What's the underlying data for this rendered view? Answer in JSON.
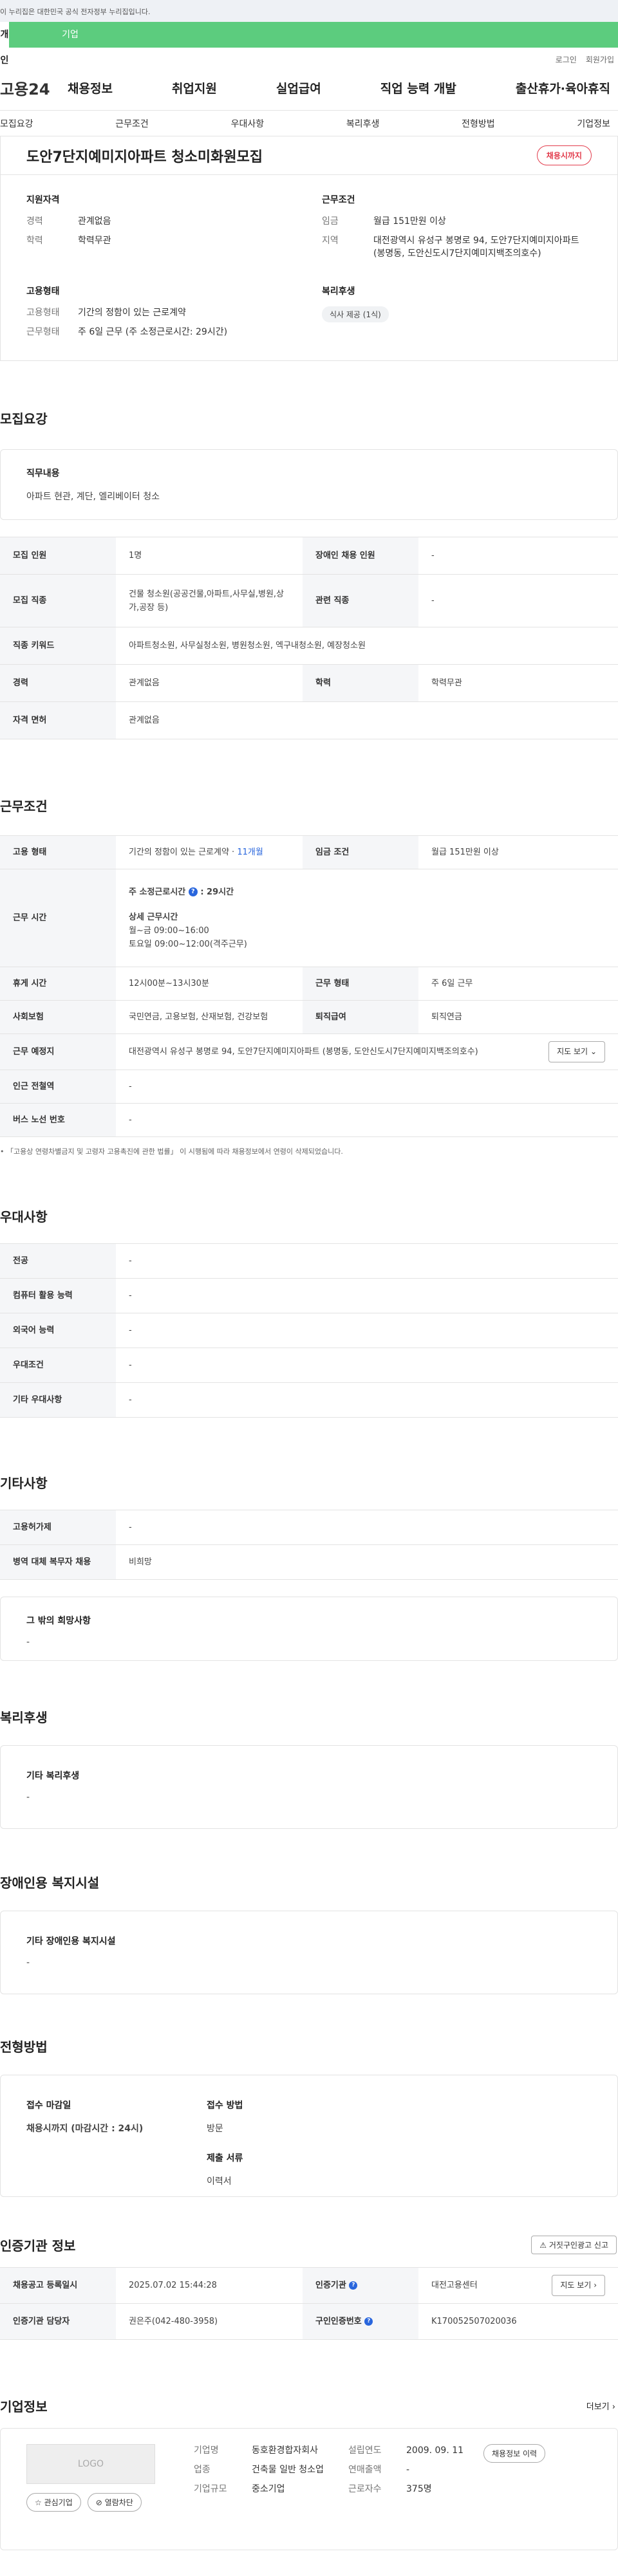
{
  "gov_banner": "이 누리집은 대한민국 공식 전자정부 누리집입니다.",
  "top_tabs": [
    "개인",
    "기업"
  ],
  "util": {
    "login": "로그인",
    "join": "회원가입"
  },
  "brand": "고용24",
  "gnb": [
    "채용정보",
    "취업지원",
    "실업급여",
    "직업 능력 개발",
    "출산휴가·육아휴직"
  ],
  "subnav": [
    "모집요강",
    "근무조건",
    "우대사항",
    "복리후생",
    "전형방법",
    "기업정보"
  ],
  "title": "도안7단지예미지아파트 청소미화원모집",
  "status_pill": "채용시까지",
  "summary": {
    "qual_title": "지원자격",
    "qual": [
      {
        "k": "경력",
        "v": "관계없음"
      },
      {
        "k": "학력",
        "v": "학력무관"
      }
    ],
    "cond_title": "근무조건",
    "cond": [
      {
        "k": "임금",
        "v": "월급 151만원 이상"
      },
      {
        "k": "지역",
        "v": "대전광역시 유성구 봉명로 94, 도안7단지예미지아파트 (봉명동, 도안신도시7단지예미지백조의호수)"
      }
    ],
    "emp_title": "고용형태",
    "emp": [
      {
        "k": "고용형태",
        "v": "기간의 정함이 있는 근로계약"
      },
      {
        "k": "근무형태",
        "v": "주 6일 근무 (주 소정근로시간: 29시간)"
      }
    ],
    "welfare_title": "복리후생",
    "welfare_chip": "식사 제공 (1식)"
  },
  "recruit": {
    "title": "모집요강",
    "duty_label": "직무내용",
    "duty_text": "아파트 현관, 계단, 엘리베이터 청소",
    "rows": [
      {
        "k1": "모집 인원",
        "v1": "1명",
        "k2": "장애인 채용 인원",
        "v2": "-"
      },
      {
        "k1": "모집 직종",
        "v1": "건물 청소원(공공건물,아파트,사무실,병원,상가,공장 등)",
        "k2": "관련 직종",
        "v2": "-"
      },
      {
        "k1": "직종 키워드",
        "v1": "아파트청소원, 사무실청소원, 병원청소원, 엑구내청소원, 예장청소원"
      },
      {
        "k1": "경력",
        "v1": "관계없음",
        "k2": "학력",
        "v2": "학력무관"
      },
      {
        "k1": "자격 면허",
        "v1": "관계없음"
      }
    ]
  },
  "conditions": {
    "title": "근무조건",
    "emp_type_label": "고용 형태",
    "emp_type_value": "기간의 정함이 있는 근로계약 · ",
    "emp_type_months": "11개월",
    "wage_label": "임금 조건",
    "wage_value": "월급 151만원 이상",
    "time_label": "근무 시간",
    "weekly_label": "주 소정근로시간",
    "weekly_value": ": 29시간",
    "detail_label": "상세 근무시간",
    "detail_line1": "월~금 09:00~16:00",
    "detail_line2": "토요일 09:00~12:00(격주근무)",
    "break_label": "휴게 시간",
    "break_value": "12시00분~13시30분",
    "form_label": "근무 형태",
    "form_value": "주 6일 근무",
    "ins_label": "사회보험",
    "ins_value": "국민연금, 고용보험, 산재보험, 건강보험",
    "sev_label": "퇴직급여",
    "sev_value": "퇴직연금",
    "place_label": "근무 예정지",
    "place_value": "대전광역시 유성구 봉명로 94, 도안7단지예미지아파트 (봉명동, 도안신도시7단지예미지백조의호수)",
    "map_button": "지도 보기",
    "subway_label": "인근 전철역",
    "subway_value": "-",
    "bus_label": "버스 노선 번호",
    "bus_value": "-",
    "note": "「고용상 연령차별금지 및 고령자 고용촉진에 관한 법률」 이 시행됨에 따라 채용정보에서 연령이 삭제되었습니다."
  },
  "prefer": {
    "title": "우대사항",
    "rows": [
      {
        "k": "전공",
        "v": "-"
      },
      {
        "k": "컴퓨터 활용 능력",
        "v": "-"
      },
      {
        "k": "외국어 능력",
        "v": "-"
      },
      {
        "k": "우대조건",
        "v": "-"
      },
      {
        "k": "기타 우대사항",
        "v": "-"
      }
    ]
  },
  "etc": {
    "title": "기타사항",
    "rows": [
      {
        "k": "고용허가제",
        "v": "-"
      },
      {
        "k": "병역 대체 복무자 채용",
        "v": "비희망"
      }
    ],
    "wish_label": "그 밖의 희망사항",
    "wish_value": "-"
  },
  "welfare": {
    "title": "복리후생",
    "label": "기타 복리후생",
    "value": "-"
  },
  "disabled": {
    "title": "장애인용 복지시설",
    "label": "기타 장애인용 복지시설",
    "value": "-"
  },
  "process": {
    "title": "전형방법",
    "deadline_label": "접수 마감일",
    "deadline_value": "채용시까지 (마감시간 : 24시)",
    "method_label": "접수 방법",
    "method_value": "방문",
    "docs_label": "제출 서류",
    "docs_value": "이력서"
  },
  "agency": {
    "title": "인증기관 정보",
    "report_button": "거짓구인광고 신고",
    "reg_label": "채용공고 등록일시",
    "reg_value": "2025.07.02 15:44:28",
    "org_label": "인증기관",
    "org_value": "대전고용센터",
    "map_button": "지도 보기",
    "mgr_label": "인증기관 담당자",
    "mgr_value": "권은주(042-480-3958)",
    "no_label": "구인인증번호",
    "no_value": "K170052507020036"
  },
  "company": {
    "title": "기업정보",
    "more": "더보기",
    "logo": "LOGO",
    "fav_button": "관심기업",
    "block_button": "열람차단",
    "name_label": "기업명",
    "name_value": "동호환경합자회사",
    "biz_label": "업종",
    "biz_value": "건축물 일반 청소업",
    "size_label": "기업규모",
    "size_value": "중소기업",
    "est_label": "설립연도",
    "est_value": "2009. 09. 11",
    "sales_label": "연매출액",
    "sales_value": "-",
    "emp_label": "근로자수",
    "emp_value": "375명",
    "history_button": "채용정보 이력"
  },
  "colors": {
    "accent_green": "#5ccc7e",
    "status_red": "#e23c4c",
    "link_blue": "#2966dd"
  }
}
